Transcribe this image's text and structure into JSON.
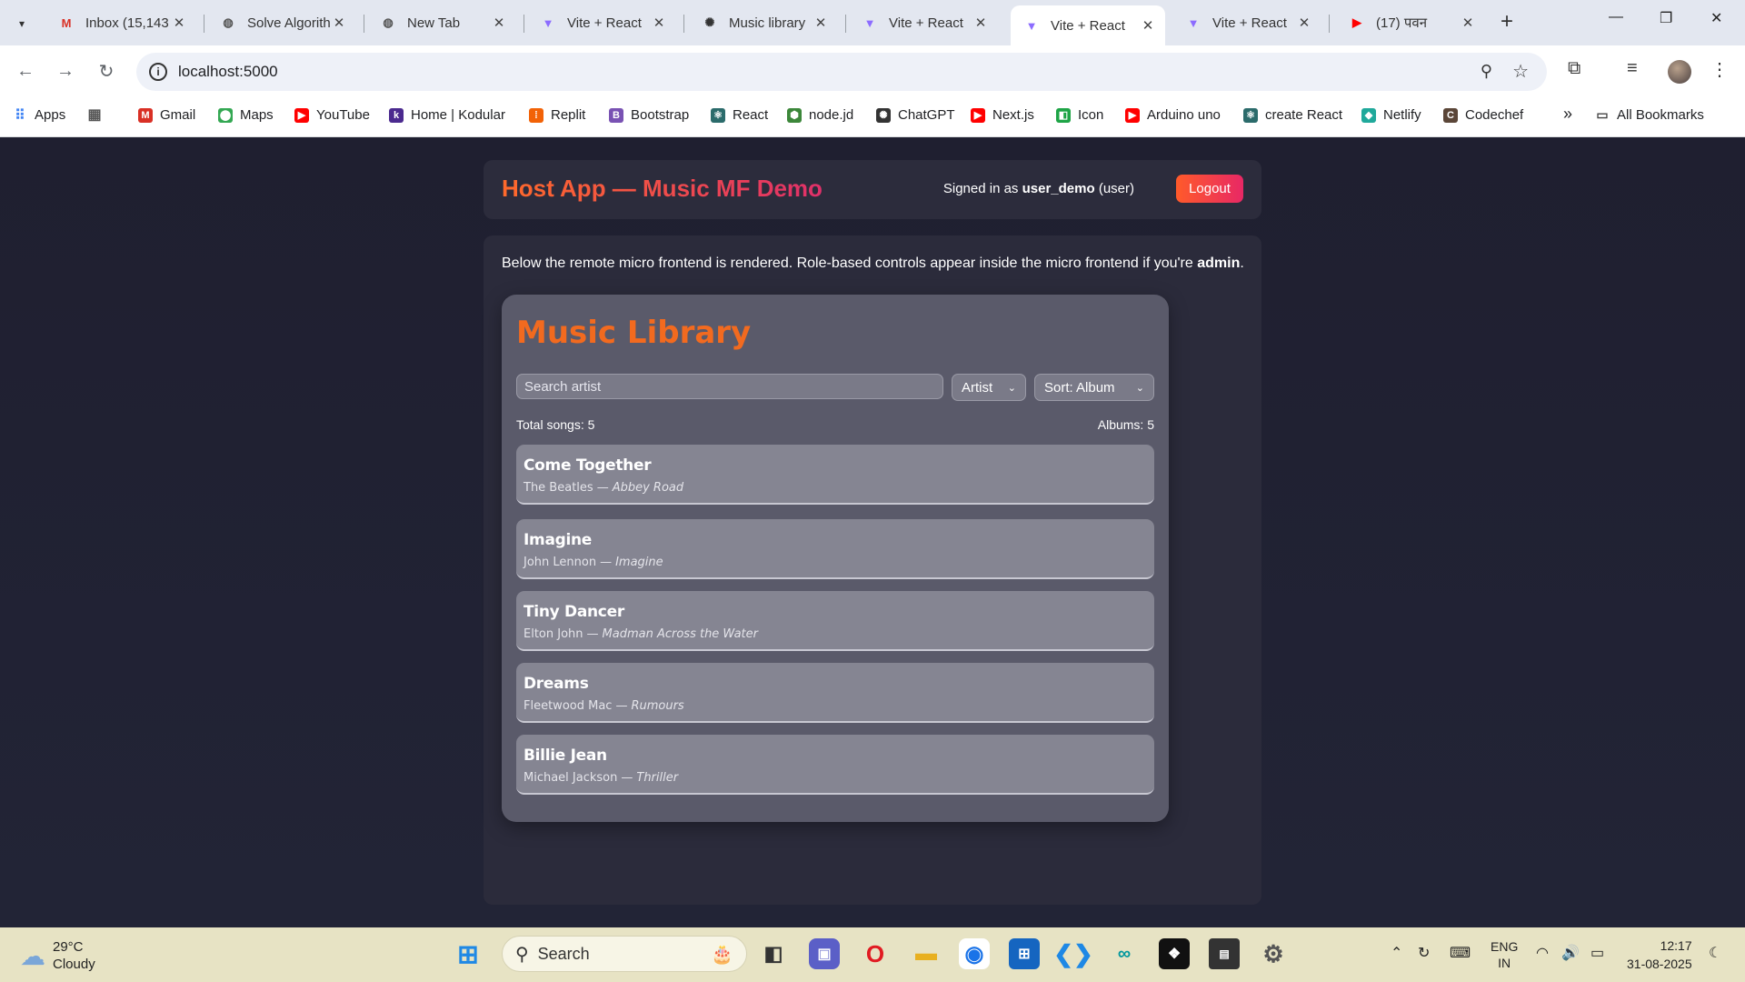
{
  "browser": {
    "tabs": [
      {
        "title": "Inbox (15,143",
        "icon": "gmail-icon",
        "color": "#d93025",
        "glyph": "M"
      },
      {
        "title": "Solve Algorith",
        "icon": "globe-icon",
        "color": "#555555",
        "glyph": "◍"
      },
      {
        "title": "New Tab",
        "icon": "chrome-icon",
        "color": "#555555",
        "glyph": "◍"
      },
      {
        "title": "Vite + React",
        "icon": "vite-icon",
        "color": "#8c6cff",
        "glyph": "▼"
      },
      {
        "title": "Music library",
        "icon": "openai-icon",
        "color": "#333333",
        "glyph": "✺"
      },
      {
        "title": "Vite + React",
        "icon": "vite-icon",
        "color": "#8c6cff",
        "glyph": "▼"
      },
      {
        "title": "Vite + React",
        "icon": "vite-icon",
        "color": "#8c6cff",
        "glyph": "▼"
      },
      {
        "title": "Vite + React",
        "icon": "vite-icon",
        "color": "#8c6cff",
        "glyph": "▼"
      },
      {
        "title": "(17) पवन",
        "icon": "youtube-icon",
        "color": "#ff0000",
        "glyph": "▶"
      }
    ],
    "url": "localhost:5000",
    "bookmarks": [
      {
        "label": "Apps",
        "icon": "apps-grid-icon",
        "color": "#4285f4",
        "glyph": "⠿"
      },
      {
        "label": "",
        "icon": "grid-icon",
        "color": "#555555",
        "glyph": "▦"
      },
      {
        "label": "Gmail",
        "icon": "gmail-icon",
        "color": "#d93025",
        "glyph": "M"
      },
      {
        "label": "Maps",
        "icon": "maps-icon",
        "color": "#34a853",
        "glyph": "⬤"
      },
      {
        "label": "YouTube",
        "icon": "youtube-icon",
        "color": "#ff0000",
        "glyph": "▶"
      },
      {
        "label": "Home | Kodular",
        "icon": "kodular-icon",
        "color": "#4b2a8f",
        "glyph": "k"
      },
      {
        "label": "Replit",
        "icon": "replit-icon",
        "color": "#f26207",
        "glyph": "⁞"
      },
      {
        "label": "Bootstrap",
        "icon": "bootstrap-icon",
        "color": "#7952b3",
        "glyph": "B"
      },
      {
        "label": "React",
        "icon": "react-icon",
        "color": "#2b6b6b",
        "glyph": "⚛"
      },
      {
        "label": "node.jd",
        "icon": "nodejs-icon",
        "color": "#3c873a",
        "glyph": "⬢"
      },
      {
        "label": "ChatGPT",
        "icon": "openai-icon",
        "color": "#333333",
        "glyph": "✺"
      },
      {
        "label": "Next.js",
        "icon": "youtube-icon",
        "color": "#ff0000",
        "glyph": "▶"
      },
      {
        "label": "Icon",
        "icon": "icon-site-icon",
        "color": "#1ea446",
        "glyph": "◧"
      },
      {
        "label": "Arduino uno",
        "icon": "youtube-icon",
        "color": "#ff0000",
        "glyph": "▶"
      },
      {
        "label": "create React",
        "icon": "react-icon",
        "color": "#2b6b6b",
        "glyph": "⚛"
      },
      {
        "label": "Netlify",
        "icon": "netlify-icon",
        "color": "#20a99b",
        "glyph": "◆"
      },
      {
        "label": "Codechef",
        "icon": "codechef-icon",
        "color": "#5b4638",
        "glyph": "C"
      }
    ],
    "bookmarks_more": "»",
    "all_bookmarks": "All Bookmarks"
  },
  "host": {
    "title": "Host App — Music MF Demo",
    "signed_prefix": "Signed in as",
    "username": "user_demo",
    "role": "(user)",
    "logout": "Logout",
    "intro_text": "Below the remote micro frontend is rendered. Role-based controls appear inside the micro frontend if you're",
    "intro_bold": "admin",
    "intro_end": "."
  },
  "music": {
    "title": "Music Library",
    "search_placeholder": "Search artist",
    "group_by": "Artist",
    "sort_by": "Sort: Album",
    "total_songs": "Total songs: 5",
    "albums": "Albums: 5",
    "songs": [
      {
        "title": "Come Together",
        "artist": "The Beatles",
        "album": "Abbey Road"
      },
      {
        "title": "Imagine",
        "artist": "John Lennon",
        "album": "Imagine"
      },
      {
        "title": "Tiny Dancer",
        "artist": "Elton John",
        "album": "Madman Across the Water"
      },
      {
        "title": "Dreams",
        "artist": "Fleetwood Mac",
        "album": "Rumours"
      },
      {
        "title": "Billie Jean",
        "artist": "Michael Jackson",
        "album": "Thriller"
      }
    ],
    "separator": "—"
  },
  "taskbar": {
    "temp": "29°C",
    "condition": "Cloudy",
    "search": "Search",
    "lang1": "ENG",
    "lang2": "IN",
    "time": "12:17",
    "date": "31-08-2025"
  }
}
